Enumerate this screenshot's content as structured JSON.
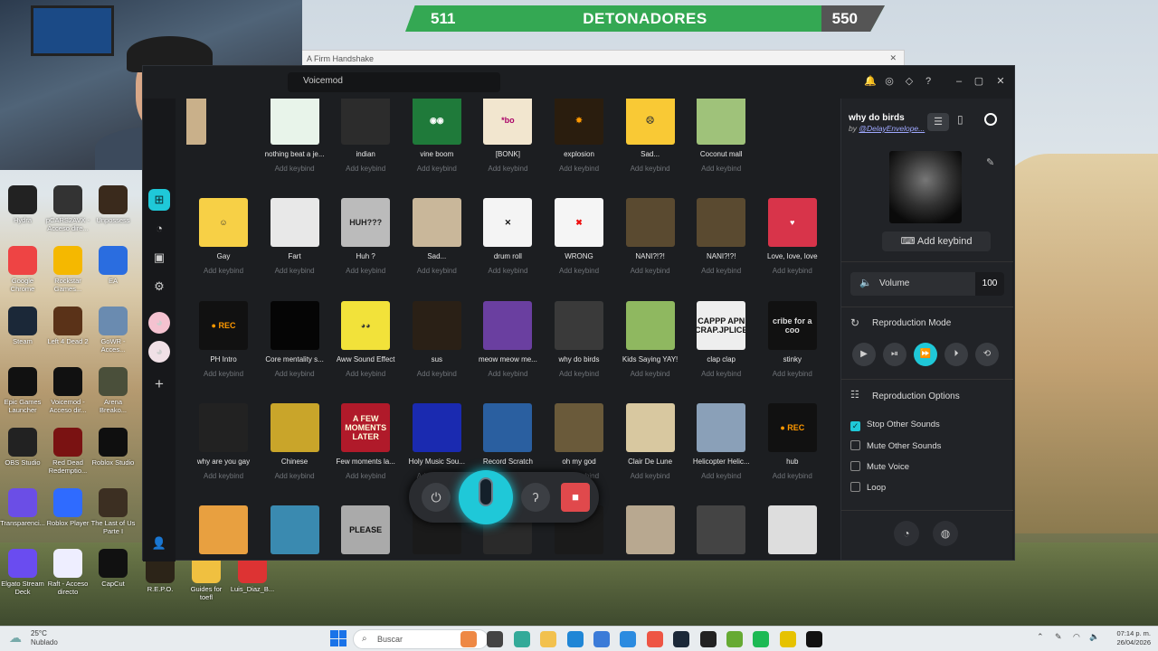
{
  "banner": {
    "left": "511",
    "title": "DETONADORES",
    "right": "550"
  },
  "background_window": {
    "title": "A Firm Handshake"
  },
  "desktop_icons": [
    {
      "label": "Hydra",
      "color": "#222"
    },
    {
      "label": "pCARS2AVX - Acceso dire...",
      "color": "#333"
    },
    {
      "label": "Unpossess",
      "color": "#3a2a1c"
    },
    {
      "label": "Google Chrome",
      "color": "#e44"
    },
    {
      "label": "Rockstar Games...",
      "color": "#f5b800"
    },
    {
      "label": "EA",
      "color": "#2a6de0"
    },
    {
      "label": "Steam",
      "color": "#1b2838"
    },
    {
      "label": "Left 4 Dead 2",
      "color": "#5a3218"
    },
    {
      "label": "GoWR - Acces...",
      "color": "#6a8bb0"
    },
    {
      "label": "Epic Games Launcher",
      "color": "#111"
    },
    {
      "label": "Voicemod - Acceso dir...",
      "color": "#111"
    },
    {
      "label": "Arena Breako...",
      "color": "#4a4f3a"
    },
    {
      "label": "OBS Studio",
      "color": "#222"
    },
    {
      "label": "Red Dead Redemptio...",
      "color": "#7a1212"
    },
    {
      "label": "Roblox Studio",
      "color": "#0f0f0f"
    },
    {
      "label": "Transparenci...",
      "color": "#6b4ee6"
    },
    {
      "label": "Roblox Player",
      "color": "#2f6bff"
    },
    {
      "label": "The Last of Us Parte I",
      "color": "#3c2f22"
    },
    {
      "label": "Elgato Stream Deck",
      "color": "#6a4cf0"
    },
    {
      "label": "Raft - Acceso directo",
      "color": "#eef"
    },
    {
      "label": "CapCut",
      "color": "#111"
    },
    {
      "label": "R.E.P.O.",
      "color": "#2c2418"
    },
    {
      "label": "Guides for toefl",
      "color": "#f0c040"
    },
    {
      "label": "Luis_Diaz_B...",
      "color": "#d33"
    }
  ],
  "app": {
    "title": "Voicemod"
  },
  "sounds": [
    {
      "name": "nothing beat a je...",
      "key": "Add keybind",
      "bg": "#e8f4ea",
      "fg": "#4a7",
      "t": ""
    },
    {
      "name": "indian",
      "key": "Add keybind",
      "bg": "#2c2c2c",
      "fg": "#aaa",
      "t": ""
    },
    {
      "name": "vine boom",
      "key": "Add keybind",
      "bg": "#1f7a3a",
      "fg": "#fff",
      "t": "◉◉"
    },
    {
      "name": "[BONK]",
      "key": "Add keybind",
      "bg": "#f2e6cf",
      "fg": "#a06",
      "t": "*bo"
    },
    {
      "name": "explosion",
      "key": "Add keybind",
      "bg": "#2a1d0e",
      "fg": "#f90",
      "t": "✸"
    },
    {
      "name": "Sad...",
      "key": "Add keybind",
      "bg": "#f9c935",
      "fg": "#333",
      "t": "☹"
    },
    {
      "name": "Coconut mall",
      "key": "Add keybind",
      "bg": "#9fc27a",
      "fg": "#333",
      "t": ""
    },
    {
      "name": "Gay",
      "key": "Add keybind",
      "bg": "#f7d046",
      "fg": "#333",
      "t": "☺"
    },
    {
      "name": "Fart",
      "key": "Add keybind",
      "bg": "#e8e8e8",
      "fg": "#2a6",
      "t": ""
    },
    {
      "name": "Huh ?",
      "key": "Add keybind",
      "bg": "#bbb",
      "fg": "#222",
      "t": "HUH???"
    },
    {
      "name": "Sad...",
      "key": "Add keybind",
      "bg": "#c9b79a",
      "fg": "#333",
      "t": ""
    },
    {
      "name": "drum roll",
      "key": "Add keybind",
      "bg": "#f4f4f4",
      "fg": "#111",
      "t": "✕"
    },
    {
      "name": "WRONG",
      "key": "Add keybind",
      "bg": "#f5f5f5",
      "fg": "#e11",
      "t": "✖"
    },
    {
      "name": "NANI?!?!",
      "key": "Add keybind",
      "bg": "#5a4a30",
      "fg": "#eee",
      "t": ""
    },
    {
      "name": "NANI?!?!",
      "key": "Add keybind",
      "bg": "#5a4a30",
      "fg": "#eee",
      "t": ""
    },
    {
      "name": "Love, love, love",
      "key": "Add keybind",
      "bg": "#d8344a",
      "fg": "#fff",
      "t": "♥"
    },
    {
      "name": "PH Intro",
      "key": "Add keybind",
      "bg": "#111",
      "fg": "#f90",
      "t": "● REC"
    },
    {
      "name": "Core mentality s...",
      "key": "Add keybind",
      "bg": "#050505",
      "fg": "#555",
      "t": ""
    },
    {
      "name": "Aww Sound Effect",
      "key": "Add keybind",
      "bg": "#f2e23a",
      "fg": "#333",
      "t": "◕◕"
    },
    {
      "name": "sus",
      "key": "Add keybind",
      "bg": "#2a2016",
      "fg": "#b87",
      "t": ""
    },
    {
      "name": "meow meow me...",
      "key": "Add keybind",
      "bg": "#6a3fa0",
      "fg": "#fff",
      "t": ""
    },
    {
      "name": "why do birds",
      "key": "Add keybind",
      "bg": "#3a3a3a",
      "fg": "#888",
      "t": ""
    },
    {
      "name": "Kids Saying YAY!",
      "key": "Add keybind",
      "bg": "#8fb860",
      "fg": "#fff",
      "t": ""
    },
    {
      "name": "clap clap",
      "key": "Add keybind",
      "bg": "#eee",
      "fg": "#111",
      "t": "CAPPP APN CRAP.JPLICE"
    },
    {
      "name": "stinky",
      "key": "Add keybind",
      "bg": "#111",
      "fg": "#ddd",
      "t": "cribe for a coo"
    },
    {
      "name": "why are you gay",
      "key": "Add keybind",
      "bg": "#222",
      "fg": "#ccc",
      "t": ""
    },
    {
      "name": "Chinese",
      "key": "Add keybind",
      "bg": "#c9a52a",
      "fg": "#222",
      "t": ""
    },
    {
      "name": "Few moments la...",
      "key": "Add keybind",
      "bg": "#b01a2a",
      "fg": "#ffd",
      "t": "A FEW MOMENTS LATER"
    },
    {
      "name": "Holy Music Sou...",
      "key": "Add keybind",
      "bg": "#1a2ab0",
      "fg": "#fff",
      "t": ""
    },
    {
      "name": "Record Scratch",
      "key": "Add keybind",
      "bg": "#2a5fa0",
      "fg": "#fff",
      "t": ""
    },
    {
      "name": "oh my god",
      "key": "Add keybind",
      "bg": "#6a5a3a",
      "fg": "#fff",
      "t": ""
    },
    {
      "name": "Clair De Lune",
      "key": "Add keybind",
      "bg": "#d8c8a0",
      "fg": "#a33",
      "t": ""
    },
    {
      "name": "Helicopter Helic...",
      "key": "Add keybind",
      "bg": "#8aa0b8",
      "fg": "#222",
      "t": ""
    },
    {
      "name": "hub",
      "key": "Add keybind",
      "bg": "#111",
      "fg": "#f90",
      "t": "● REC"
    },
    {
      "name": "",
      "key": "",
      "bg": "#e8a040",
      "fg": "#222",
      "t": ""
    },
    {
      "name": "",
      "key": "",
      "bg": "#3a8ab0",
      "fg": "#fff",
      "t": ""
    },
    {
      "name": "",
      "key": "",
      "bg": "#aaa",
      "fg": "#111",
      "t": "PLEASE"
    },
    {
      "name": "",
      "key": "",
      "bg": "#1a1a1a",
      "fg": "#ccc",
      "t": ""
    },
    {
      "name": "",
      "key": "",
      "bg": "#2a2a2a",
      "fg": "#ccc",
      "t": ""
    },
    {
      "name": "",
      "key": "",
      "bg": "#1a1a1a",
      "fg": "#ccc",
      "t": ""
    },
    {
      "name": "",
      "key": "",
      "bg": "#b8a890",
      "fg": "#222",
      "t": ""
    },
    {
      "name": "",
      "key": "",
      "bg": "#444",
      "fg": "#ddd",
      "t": ""
    },
    {
      "name": "",
      "key": "",
      "bg": "#ddd",
      "fg": "#111",
      "t": ""
    }
  ],
  "top_partial_keys": [
    "Add keybind",
    "Add keybind",
    "Add keybind",
    "Add keybind",
    "Add keybind",
    "Add keybind",
    "Add keybind"
  ],
  "panel": {
    "title": "why do birds",
    "by": "by",
    "author": "@DelayEnvelope...",
    "add_keybind": "Add keybind",
    "volume_label": "Volume",
    "volume_value": "100",
    "mode_title": "Reproduction Mode",
    "options_title": "Reproduction Options",
    "options": [
      {
        "label": "Stop Other Sounds",
        "checked": true
      },
      {
        "label": "Mute Other Sounds",
        "checked": false
      },
      {
        "label": "Mute Voice",
        "checked": false
      },
      {
        "label": "Loop",
        "checked": false
      }
    ]
  },
  "taskbar": {
    "temperature": "25°C",
    "weather": "Nublado",
    "search_placeholder": "Buscar",
    "time": "07:14 p. m.",
    "date": "26/04/2026"
  }
}
